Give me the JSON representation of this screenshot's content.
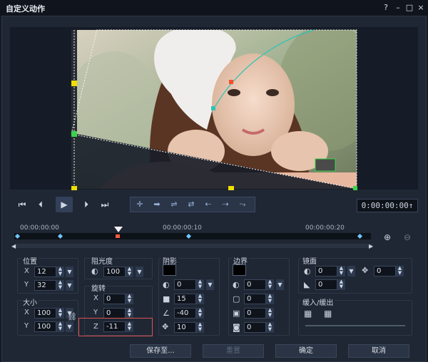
{
  "window": {
    "title": "自定义动作",
    "help": "?",
    "minimize": "–",
    "maximize": "□",
    "close": "×"
  },
  "player": {
    "timecode": "0:00:00:00↑"
  },
  "timeline": {
    "labels": [
      "00:00:00:00",
      "00:00:00:10",
      "00:00:00:20"
    ]
  },
  "position": {
    "label": "位置",
    "x": "12",
    "y": "32"
  },
  "size": {
    "label": "大小",
    "x": "100",
    "y": "100"
  },
  "opacity": {
    "label": "阻光度",
    "value": "100"
  },
  "rotation": {
    "label": "旋转",
    "x": "0",
    "y": "0",
    "z": "-11"
  },
  "shadow": {
    "label": "阴影",
    "v1": "0",
    "v2": "15",
    "v3": "-40",
    "v4": "10"
  },
  "border": {
    "label": "边界",
    "v1": "0",
    "v2": "0",
    "v3": "0",
    "v4": "0"
  },
  "mirror": {
    "label": "镜面",
    "v1": "0",
    "v2": "0",
    "v3": "0"
  },
  "ease": {
    "label": "缓入/缓出"
  },
  "axes": {
    "x": "X",
    "y": "Y",
    "z": "Z"
  },
  "buttons": {
    "save_to": "保存至...",
    "reset": "重置",
    "ok": "确定",
    "cancel": "取消"
  },
  "colors": {
    "highlight": "#e05252",
    "motion_path": "#2ec4b6",
    "keyframe": "#6ec6ff"
  }
}
